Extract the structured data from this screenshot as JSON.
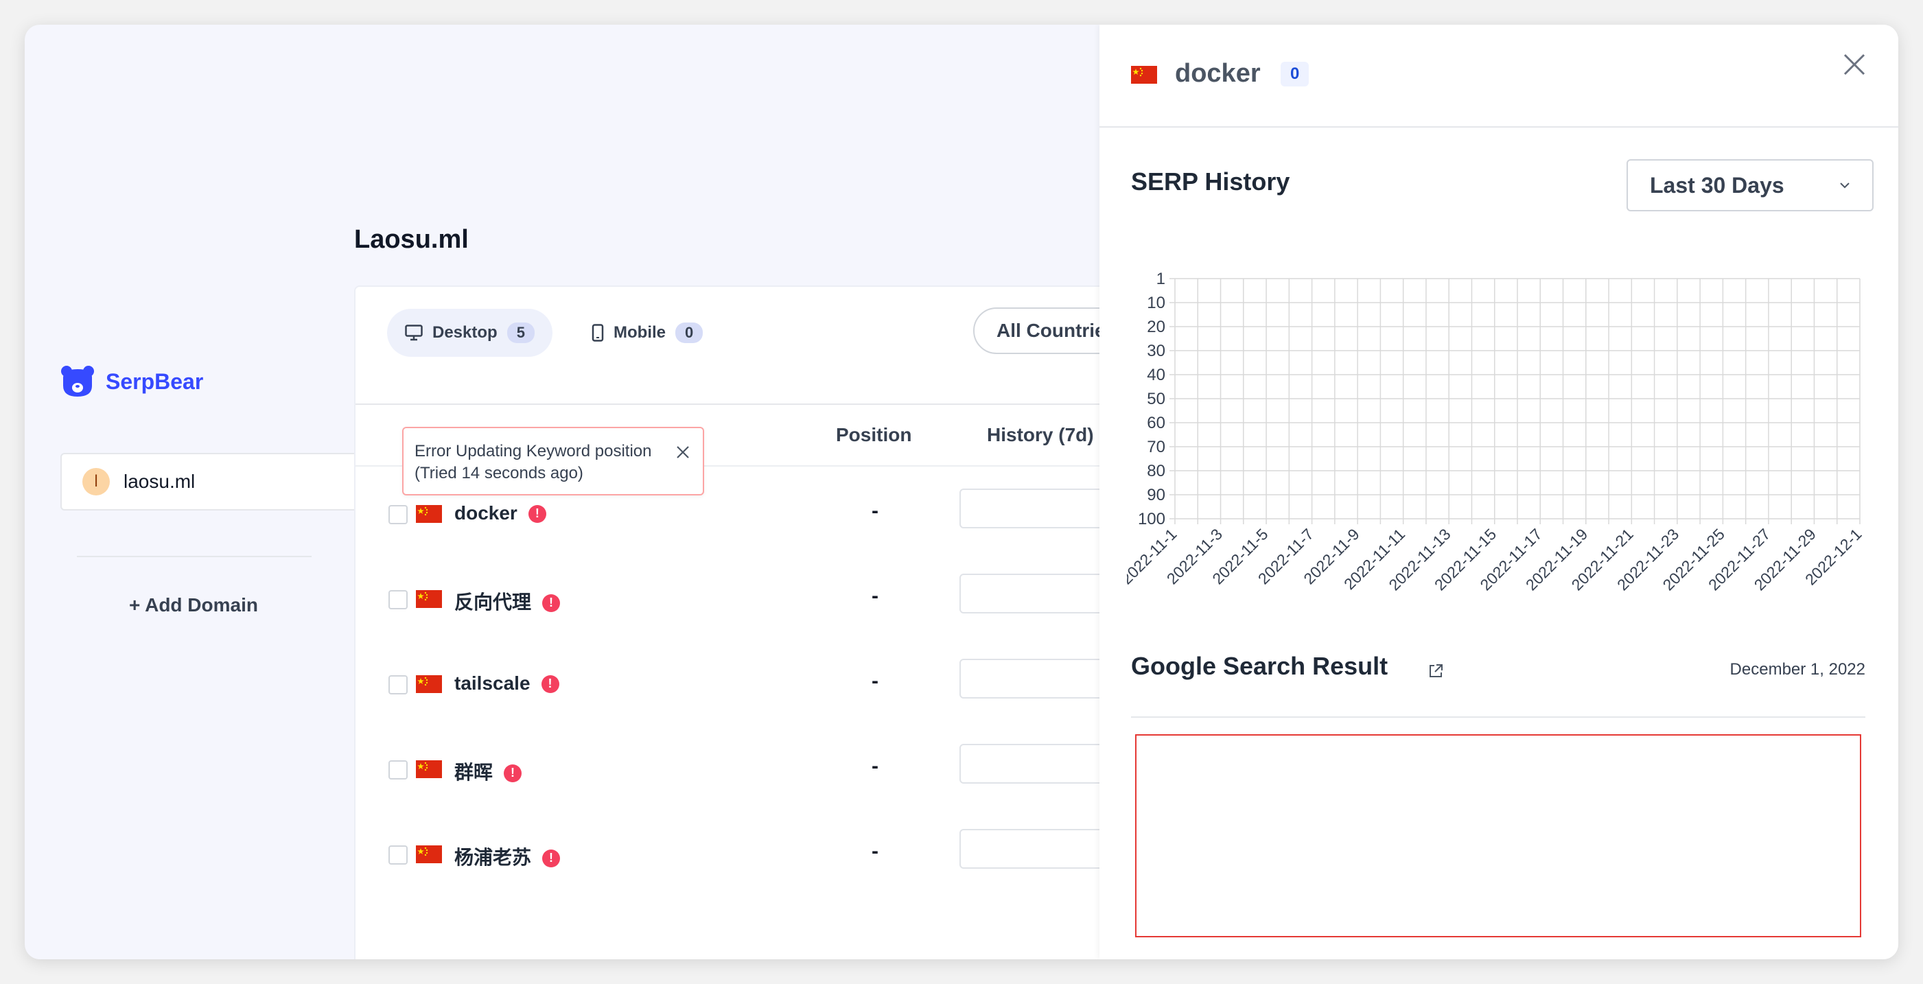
{
  "sidebar": {
    "brand_name": "SerpBear",
    "domains": [
      {
        "initial": "l",
        "name": "laosu.ml"
      }
    ],
    "add_domain_label": "+ Add Domain"
  },
  "main": {
    "domain_title": "Laosu.ml",
    "tabs": [
      {
        "label": "Desktop",
        "count": "5",
        "icon": "desktop-icon"
      },
      {
        "label": "Mobile",
        "count": "0",
        "icon": "mobile-icon"
      }
    ],
    "countries_filter": "All Countries",
    "columns": {
      "position": "Position",
      "history": "History (7d)"
    },
    "keywords": [
      {
        "keyword": "docker",
        "position": "-",
        "flag": "cn-flag"
      },
      {
        "keyword": "反向代理",
        "position": "-",
        "flag": "cn-flag"
      },
      {
        "keyword": "tailscale",
        "position": "-",
        "flag": "cn-flag"
      },
      {
        "keyword": "群晖",
        "position": "-",
        "flag": "cn-flag"
      },
      {
        "keyword": "杨浦老苏",
        "position": "-",
        "flag": "cn-flag"
      }
    ]
  },
  "toast": {
    "line1": "Error Updating Keyword position",
    "line2": "(Tried 14 seconds ago)"
  },
  "panel": {
    "keyword": "docker",
    "badge": "0",
    "serp_title": "SERP History",
    "range": "Last 30 Days",
    "gsr_title": "Google Search Result",
    "gsr_date": "December 1, 2022"
  },
  "colors": {
    "accent": "#364aff",
    "error": "#f43f5e",
    "frame": "#e53935"
  },
  "chart_data": {
    "type": "line",
    "title": "",
    "xlabel": "",
    "ylabel": "",
    "y_reversed": true,
    "ylim": [
      1,
      100
    ],
    "y_ticks": [
      "1",
      "10",
      "20",
      "30",
      "40",
      "50",
      "60",
      "70",
      "80",
      "90",
      "100"
    ],
    "x_ticks": [
      "2022-11-1",
      "2022-11-3",
      "2022-11-5",
      "2022-11-7",
      "2022-11-9",
      "2022-11-11",
      "2022-11-13",
      "2022-11-15",
      "2022-11-17",
      "2022-11-19",
      "2022-11-21",
      "2022-11-23",
      "2022-11-25",
      "2022-11-27",
      "2022-11-29",
      "2022-12-1"
    ],
    "series": [],
    "grid": true
  }
}
